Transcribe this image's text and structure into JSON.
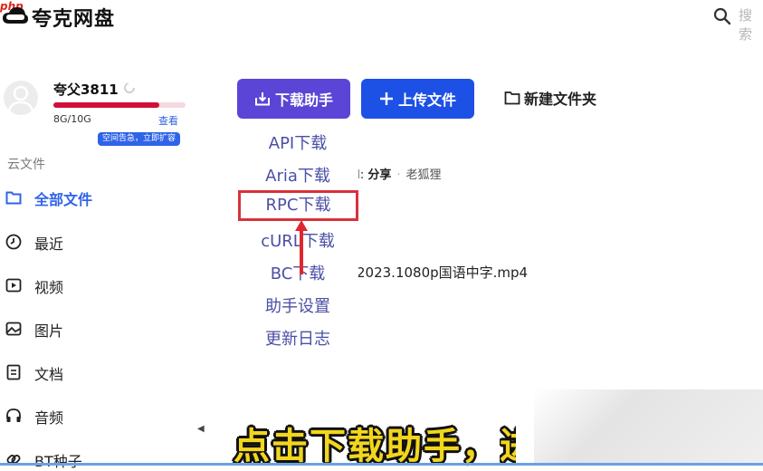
{
  "header": {
    "app_name": "夸克网盘",
    "watermark": "php",
    "search_placeholder": "搜索"
  },
  "user": {
    "name": "夸父3811",
    "quota_text": "8G/10G",
    "quota_used_fraction": 0.8,
    "view_link": "查看",
    "expand_badge": "空间告急，立即扩容"
  },
  "sidebar": {
    "section_title": "云文件",
    "items": [
      {
        "label": "全部文件",
        "icon": "folder-icon",
        "active": true
      },
      {
        "label": "最近",
        "icon": "clock-icon"
      },
      {
        "label": "视频",
        "icon": "video-icon"
      },
      {
        "label": "图片",
        "icon": "image-icon"
      },
      {
        "label": "文档",
        "icon": "document-icon"
      },
      {
        "label": "音频",
        "icon": "headphones-icon"
      },
      {
        "label": "BT种子",
        "icon": "link-icon"
      }
    ]
  },
  "toolbar": {
    "download_helper": "下载助手",
    "upload": "上传文件",
    "new_folder": "新建文件夹"
  },
  "download_menu": {
    "items": [
      "API下载",
      "Aria下载",
      "RPC下载",
      "cURL下载",
      "BC下载",
      "助手设置",
      "更新日志"
    ],
    "highlighted": "RPC下载"
  },
  "content": {
    "breadcrumb_prefix": "I:",
    "breadcrumb_share": "分享",
    "breadcrumb_folder": "老狐狸",
    "filename": "2023.1080p国语中字.mp4"
  },
  "subtitle": "点击下载助手，",
  "subtitle_cut": "进",
  "colors": {
    "download_button": "#5a45d6",
    "upload_button": "#1d51e6",
    "highlight_border": "#d8323a",
    "quota_fill": "#d0103a",
    "subtitle": "#f2d61c"
  }
}
